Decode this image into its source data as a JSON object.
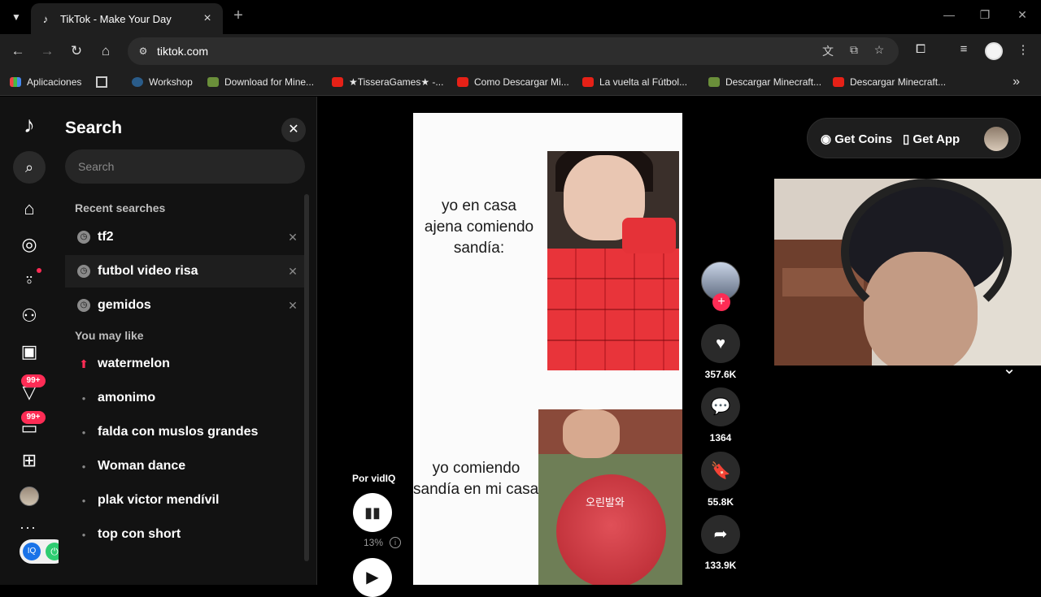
{
  "browser": {
    "tab_title": "TikTok - Make Your Day",
    "url": "tiktok.com",
    "bookmarks": [
      {
        "label": "Aplicaciones",
        "icon": "apps-icon"
      },
      {
        "label": "Workshop",
        "icon": "steam-icon"
      },
      {
        "label": "Download for Mine...",
        "icon": "minecraft-icon"
      },
      {
        "label": "★TisseraGames★ -...",
        "icon": "youtube-icon"
      },
      {
        "label": "Como Descargar Mi...",
        "icon": "youtube-icon"
      },
      {
        "label": "La vuelta al Fútbol...",
        "icon": "youtube-icon"
      },
      {
        "label": "Descargar Minecraft...",
        "icon": "minecraft-icon"
      },
      {
        "label": "Descargar Minecraft...",
        "icon": "youtube-icon"
      }
    ]
  },
  "rail": {
    "badges": [
      "99+",
      "99+"
    ]
  },
  "search_panel": {
    "title": "Search",
    "placeholder": "Search",
    "recent_label": "Recent searches",
    "recent": [
      "tf2",
      "futbol video risa",
      "gemidos"
    ],
    "like_label": "You may like",
    "suggestions": [
      "watermelon",
      "amonimo",
      "falda con muslos grandes",
      "Woman dance",
      "plak victor mendívil",
      "top con short"
    ]
  },
  "video": {
    "caption_top": [
      "yo en casa",
      "ajena comiendo",
      "sandía:"
    ],
    "caption_bottom": [
      "yo comiendo",
      "sandía en mi casa:"
    ],
    "overlay_korean": "오린발와"
  },
  "actions": {
    "likes": "357.6K",
    "comments": "1364",
    "saves": "55.8K",
    "shares": "133.9K"
  },
  "vidiq": {
    "label": "Por vidIQ",
    "percent": "13%"
  },
  "top_right": {
    "coins": "Get Coins",
    "app": "Get App"
  }
}
